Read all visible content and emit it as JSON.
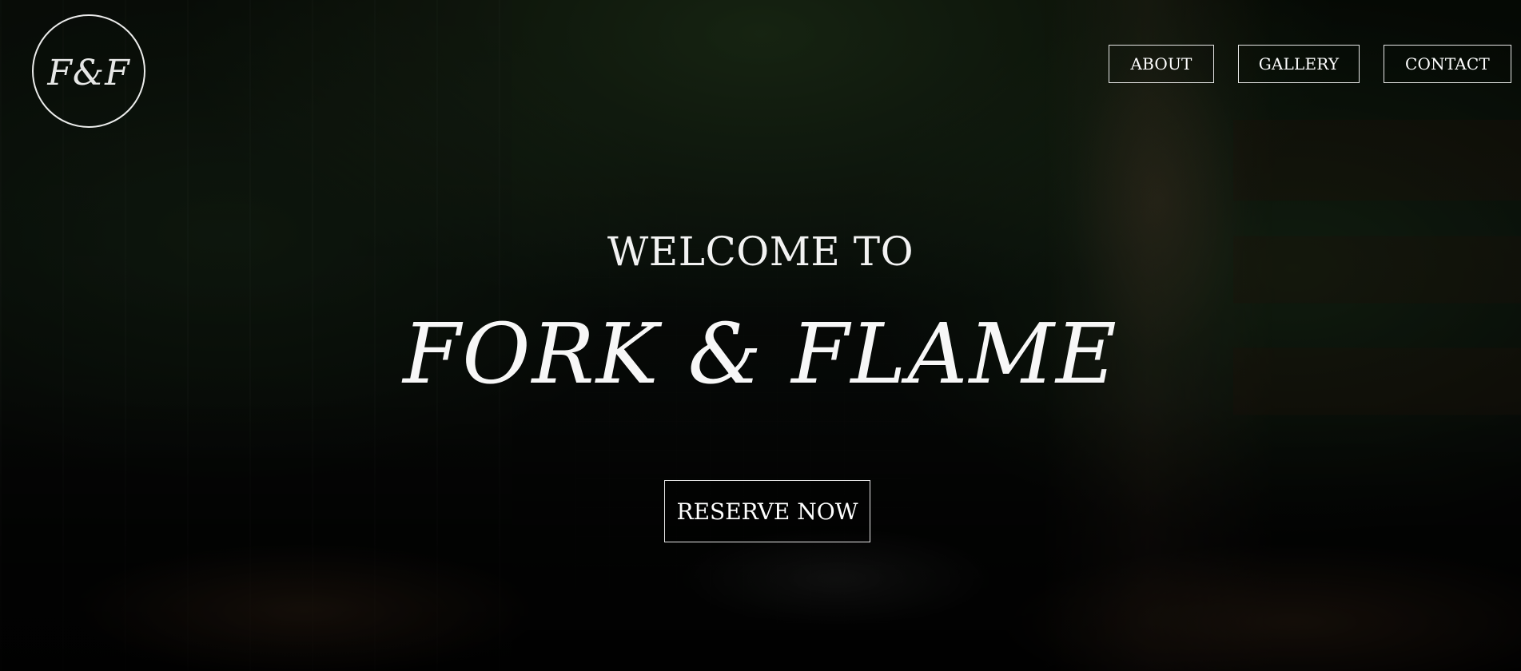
{
  "brand": {
    "logo_text": "F&F"
  },
  "nav": {
    "about_label": "ABOUT",
    "gallery_label": "GALLERY",
    "contact_label": "CONTACT"
  },
  "hero": {
    "welcome_text": "WELCOME TO",
    "title_text": "FORK & FLAME",
    "cta_label": "RESERVE NOW"
  }
}
